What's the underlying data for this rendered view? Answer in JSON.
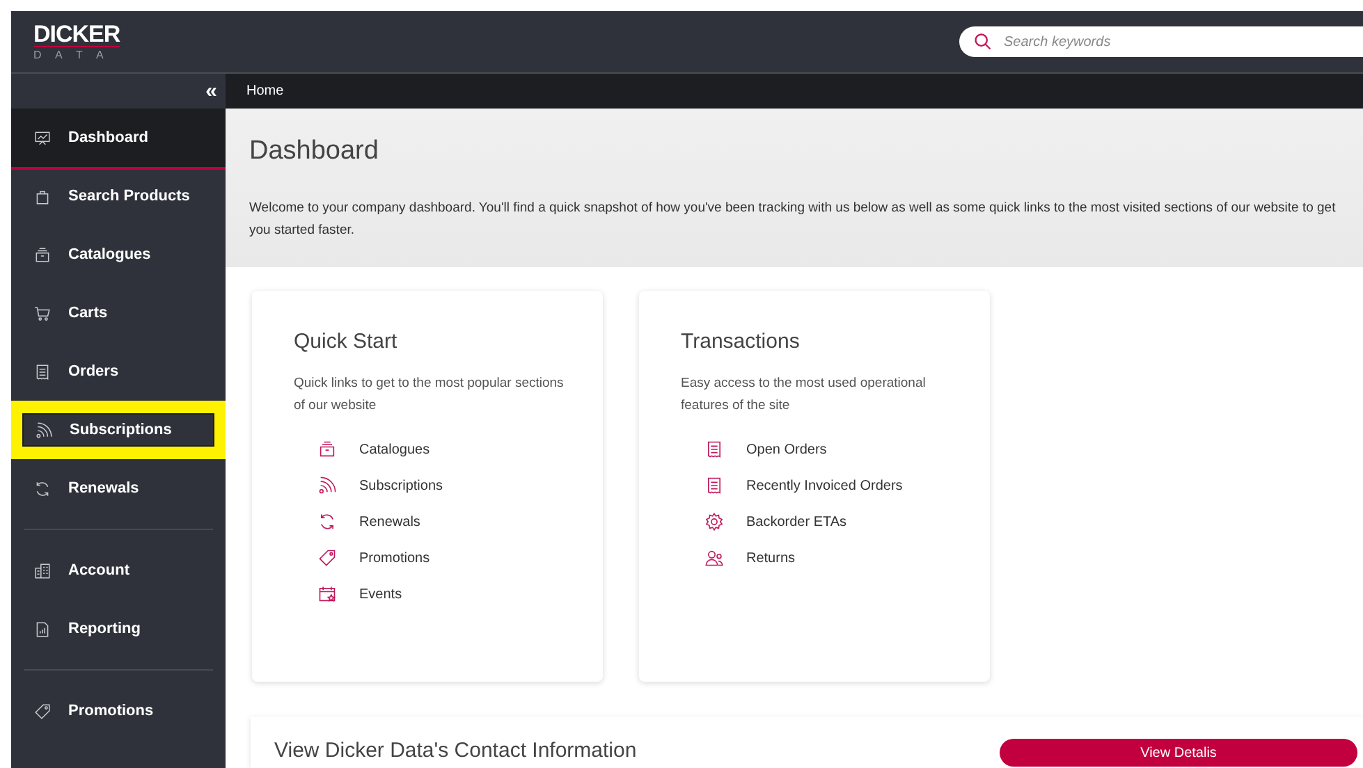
{
  "header": {
    "logo_top": "DICKER",
    "logo_bottom": "D A T A",
    "search": {
      "placeholder": "Search keywords"
    }
  },
  "sidebar": {
    "collapse": "«",
    "sections": [
      [
        {
          "label": "Dashboard",
          "selected": true,
          "highlighted": false
        },
        {
          "label": "Search Products",
          "selected": false,
          "highlighted": false
        },
        {
          "label": "Catalogues",
          "selected": false,
          "highlighted": false
        },
        {
          "label": "Carts",
          "selected": false,
          "highlighted": false
        },
        {
          "label": "Orders",
          "selected": false,
          "highlighted": false
        },
        {
          "label": "Subscriptions",
          "selected": false,
          "highlighted": true
        },
        {
          "label": "Renewals",
          "selected": false,
          "highlighted": false
        }
      ],
      [
        {
          "label": "Account",
          "selected": false,
          "highlighted": false
        },
        {
          "label": "Reporting",
          "selected": false,
          "highlighted": false
        }
      ],
      [
        {
          "label": "Promotions",
          "selected": false,
          "highlighted": false
        }
      ]
    ]
  },
  "breadcrumb": "Home",
  "page": {
    "title": "Dashboard",
    "intro": "Welcome to your company dashboard. You'll find a quick snapshot of how you've been tracking with us below as well as some quick links to the most visited sections of our website to get you started faster."
  },
  "cards": [
    {
      "title": "Quick Start",
      "description": "Quick links to get to the most popular sections of our website",
      "links": [
        "Catalogues",
        "Subscriptions",
        "Renewals",
        "Promotions",
        "Events"
      ]
    },
    {
      "title": "Transactions",
      "description": "Easy access to the most used operational features of the site",
      "links": [
        "Open Orders",
        "Recently Invoiced Orders",
        "Backorder ETAs",
        "Returns"
      ]
    }
  ],
  "contact": {
    "title": "View Dicker Data's Contact Information",
    "button": "View Detalis"
  }
}
